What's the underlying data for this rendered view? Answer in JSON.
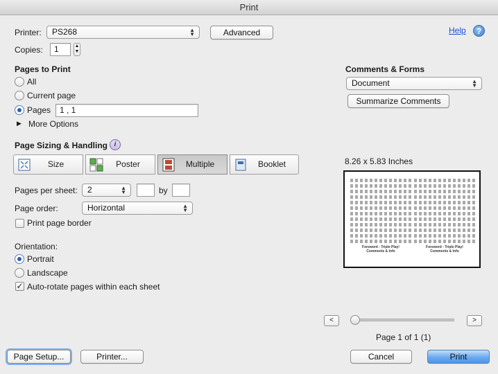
{
  "window": {
    "title": "Print"
  },
  "printer": {
    "label": "Printer:",
    "value": "PS268",
    "advanced_label": "Advanced"
  },
  "help": {
    "link_label": "Help",
    "icon": "?"
  },
  "copies": {
    "label": "Copies:",
    "value": "1"
  },
  "pages_to_print": {
    "heading": "Pages to Print",
    "all_label": "All",
    "current_label": "Current page",
    "pages_label": "Pages",
    "pages_value": "1 , 1",
    "more_options_label": "More Options",
    "selected": "pages"
  },
  "comments_forms": {
    "heading": "Comments & Forms",
    "value": "Document",
    "summarize_label": "Summarize Comments"
  },
  "sizing": {
    "heading": "Page Sizing & Handling",
    "info_icon": "i",
    "tabs": [
      {
        "label": "Size",
        "active": false
      },
      {
        "label": "Poster",
        "active": false
      },
      {
        "label": "Multiple",
        "active": true
      },
      {
        "label": "Booklet",
        "active": false
      }
    ],
    "pages_per_sheet_label": "Pages per sheet:",
    "pages_per_sheet_value": "2",
    "by_label": "by",
    "page_order_label": "Page order:",
    "page_order_value": "Horizontal",
    "print_border_label": "Print page border",
    "print_border_checked": false
  },
  "orientation": {
    "heading": "Orientation:",
    "portrait_label": "Portrait",
    "landscape_label": "Landscape",
    "selected": "portrait",
    "auto_rotate_label": "Auto-rotate pages within each sheet",
    "auto_rotate_checked": true
  },
  "preview": {
    "size_label": "8.26 x 5.83 Inches",
    "footer_text_1": "Foreword - Triple Play!",
    "footer_text_2": "Comments & Info",
    "page_label": "Page 1 of 1 (1)",
    "prev_label": "<",
    "next_label": ">"
  },
  "footer": {
    "page_setup_label": "Page Setup...",
    "printer_label": "Printer...",
    "cancel_label": "Cancel",
    "print_label": "Print"
  },
  "colors": {
    "accent": "#4f95e8",
    "link": "#1a4dd0"
  }
}
